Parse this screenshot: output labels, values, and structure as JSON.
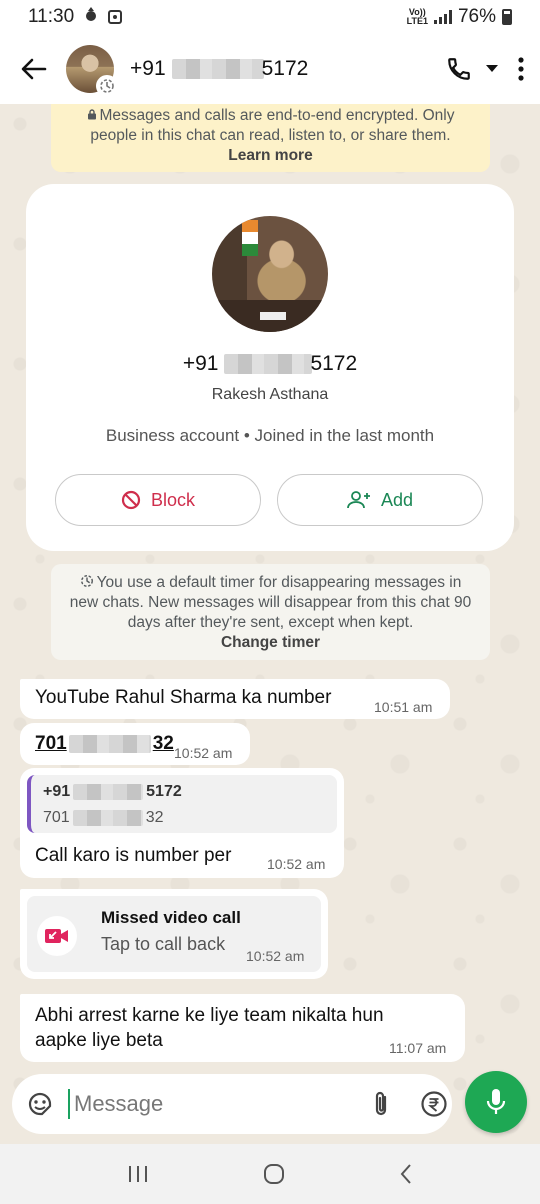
{
  "status_bar": {
    "time": "11:30",
    "network": "VoLTE",
    "battery": "76%"
  },
  "header": {
    "number_prefix": "+91",
    "number_suffix": "5172"
  },
  "encryption_banner": {
    "text": "Messages and calls are end-to-end encrypted. Only people in this chat can read, listen to, or share them.",
    "link": "Learn more"
  },
  "profile": {
    "number_prefix": "+91",
    "number_suffix": "5172",
    "name": "Rakesh Asthana",
    "meta": "Business account • Joined in the last month",
    "block_label": "Block",
    "add_label": "Add"
  },
  "system_note": {
    "text": "You use a default timer for disappearing messages in new chats. New messages will disappear from this chat 90 days after they're sent, except when kept.",
    "link": "Change timer"
  },
  "messages": [
    {
      "text": "YouTube Rahul Sharma ka number",
      "time": "10:51 am"
    },
    {
      "link_prefix": "701",
      "link_suffix": "32",
      "time": "10:52 am"
    },
    {
      "quote_prefix": "+91",
      "quote_suffix": "5172",
      "quote_body_prefix": "701",
      "quote_body_suffix": "32",
      "text": "Call karo is number per",
      "time": "10:52 am"
    },
    {
      "title": "Missed video call",
      "subtitle": "Tap to call back",
      "time": "10:52 am"
    },
    {
      "text": "Abhi arrest karne ke liye team nikalta hun aapke liye beta",
      "time": "11:07 am"
    }
  ],
  "input": {
    "placeholder": "Message"
  },
  "colors": {
    "accent": "#1ea854",
    "block": "#cf2e4c",
    "add": "#1b8755",
    "missed": "#e0245e",
    "banner": "#fdf2c9"
  }
}
